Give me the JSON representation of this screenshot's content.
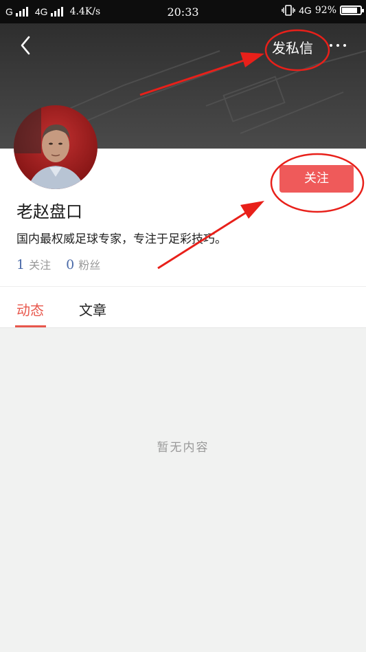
{
  "status_bar": {
    "carrier1": "G",
    "carrier2": "4G",
    "speed": "4.4K/s",
    "time": "20:33",
    "network": "4G",
    "battery": "92%",
    "battery_level": 0.92
  },
  "header": {
    "send_message": "发私信"
  },
  "profile": {
    "name": "老赵盘口",
    "bio": "国内最权威足球专家，专注于足彩技巧。",
    "follow_label": "关注",
    "following_count": "1",
    "following_label": "关注",
    "fans_count": "0",
    "fans_label": "粉丝"
  },
  "tabs": [
    {
      "label": "动态",
      "active": true
    },
    {
      "label": "文章",
      "active": false
    }
  ],
  "content": {
    "empty_text": "暂无内容"
  },
  "colors": {
    "accent": "#e8574c",
    "follow_button": "#ef5a5a",
    "annotation": "#e8201a"
  }
}
